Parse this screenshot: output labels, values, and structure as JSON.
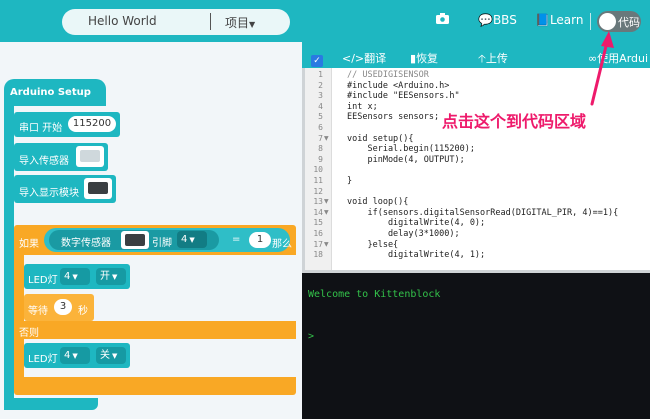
{
  "topbar": {
    "project_name": "Hello World",
    "project_menu": "项目",
    "bbs": "BBS",
    "learn": "Learn",
    "toggle_label": "代码",
    "accent_color": "#1eb7c1"
  },
  "blocks": {
    "setup_label": "Arduino Setup",
    "serial_label": "串口 开始",
    "serial_baud": "115200",
    "import_sensor": "导入传感器",
    "import_display": "导入显示模块",
    "if_label": "如果",
    "digital_sensor": "数字传感器",
    "pin_label": "引脚",
    "pin_value": "4",
    "equals": "=",
    "compare_value": "1",
    "then_label": "那么",
    "led_label_1": "LED灯",
    "led_pin_1": "4",
    "led_state_1": "开",
    "wait_label": "等待",
    "wait_value": "3",
    "wait_unit": "秒",
    "else_label": "否则",
    "led_label_2": "LED灯",
    "led_pin_2": "4",
    "led_state_2": "关"
  },
  "code_toolbar": {
    "translate": "翻译",
    "restore": "恢复",
    "upload": "上传",
    "use_arduino": "使用Ardui"
  },
  "code_lines": [
    {
      "n": "1",
      "fold": "",
      "text": "// USEDIGISENSOR"
    },
    {
      "n": "2",
      "fold": "",
      "text": "#include <Arduino.h>"
    },
    {
      "n": "3",
      "fold": "",
      "text": "#include \"EESensors.h\""
    },
    {
      "n": "4",
      "fold": "",
      "text": "int x;"
    },
    {
      "n": "5",
      "fold": "",
      "text": "EESensors sensors;"
    },
    {
      "n": "6",
      "fold": "",
      "text": ""
    },
    {
      "n": "7",
      "fold": "▼",
      "text": "void setup(){"
    },
    {
      "n": "8",
      "fold": "",
      "text": "    Serial.begin(115200);"
    },
    {
      "n": "9",
      "fold": "",
      "text": "    pinMode(4, OUTPUT);"
    },
    {
      "n": "10",
      "fold": "",
      "text": ""
    },
    {
      "n": "11",
      "fold": "",
      "text": "}"
    },
    {
      "n": "12",
      "fold": "",
      "text": ""
    },
    {
      "n": "13",
      "fold": "▼",
      "text": "void loop(){"
    },
    {
      "n": "14",
      "fold": "▼",
      "text": "    if(sensors.digitalSensorRead(DIGITAL_PIR, 4)==1){"
    },
    {
      "n": "15",
      "fold": "",
      "text": "        digitalWrite(4, 0);"
    },
    {
      "n": "16",
      "fold": "",
      "text": "        delay(3*1000);"
    },
    {
      "n": "17",
      "fold": "▼",
      "text": "    }else{"
    },
    {
      "n": "18",
      "fold": "",
      "text": "        digitalWrite(4, 1);"
    }
  ],
  "console": {
    "welcome": "Welcome to Kittenblock",
    "prompt": ">"
  },
  "annotation": {
    "text": "点击这个到代码区域",
    "color": "#ee1a6b"
  }
}
